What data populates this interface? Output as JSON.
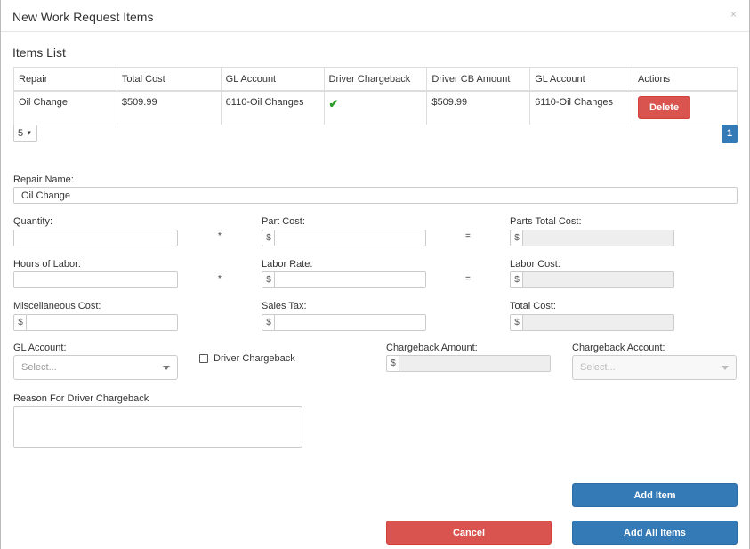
{
  "modal": {
    "title": "New Work Request Items",
    "close": "×"
  },
  "items_list": {
    "title": "Items List",
    "headers": [
      "Repair",
      "Total Cost",
      "GL Account",
      "Driver Chargeback",
      "Driver CB Amount",
      "GL Account",
      "Actions"
    ],
    "rows": [
      {
        "repair": "Oil Change",
        "total_cost": "$509.99",
        "gl_account": "6110-Oil Changes",
        "driver_chargeback": "✔",
        "driver_cb_amount": "$509.99",
        "gl_account_2": "6110-Oil Changes",
        "action": "Delete"
      }
    ],
    "page_size": "5",
    "page_size_caret": "▼",
    "current_page": "1"
  },
  "form": {
    "repair_name_label": "Repair Name:",
    "repair_name_value": "Oil Change",
    "quantity_label": "Quantity:",
    "part_cost_label": "Part Cost:",
    "parts_total_cost_label": "Parts Total Cost:",
    "hours_of_labor_label": "Hours of Labor:",
    "labor_rate_label": "Labor Rate:",
    "labor_cost_label": "Labor Cost:",
    "misc_cost_label": "Miscellaneous Cost:",
    "sales_tax_label": "Sales Tax:",
    "total_cost_label": "Total Cost:",
    "gl_account_label": "GL Account:",
    "gl_account_placeholder": "Select...",
    "driver_chargeback_label": "Driver Chargeback",
    "chargeback_amount_label": "Chargeback Amount:",
    "chargeback_account_label": "Chargeback Account:",
    "chargeback_account_placeholder": "Select...",
    "reason_label": "Reason For Driver Chargeback",
    "currency_symbol": "$",
    "multiply_op": "*",
    "equals_op": "="
  },
  "buttons": {
    "add_item": "Add Item",
    "cancel": "Cancel",
    "add_all_items": "Add All Items"
  },
  "colors": {
    "primary": "#337ab7",
    "danger": "#d9534f",
    "check": "#2a9a2a"
  }
}
